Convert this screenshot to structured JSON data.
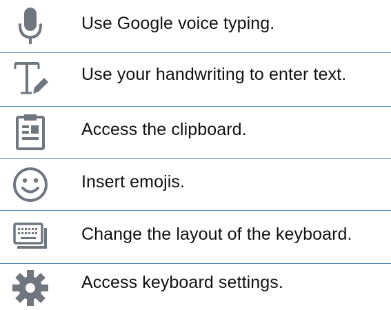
{
  "colors": {
    "icon": "#6f767e",
    "divider": "#5a86b4",
    "text": "#111111"
  },
  "features": [
    {
      "icon": "microphone-icon",
      "label": "Use Google voice typing."
    },
    {
      "icon": "handwriting-icon",
      "label": "Use your handwriting to enter text."
    },
    {
      "icon": "clipboard-icon",
      "label": "Access the clipboard."
    },
    {
      "icon": "emoji-icon",
      "label": "Insert emojis."
    },
    {
      "icon": "keyboard-layout-icon",
      "label": "Change the layout of the keyboard."
    },
    {
      "icon": "settings-gear-icon",
      "label": "Access keyboard settings."
    }
  ]
}
